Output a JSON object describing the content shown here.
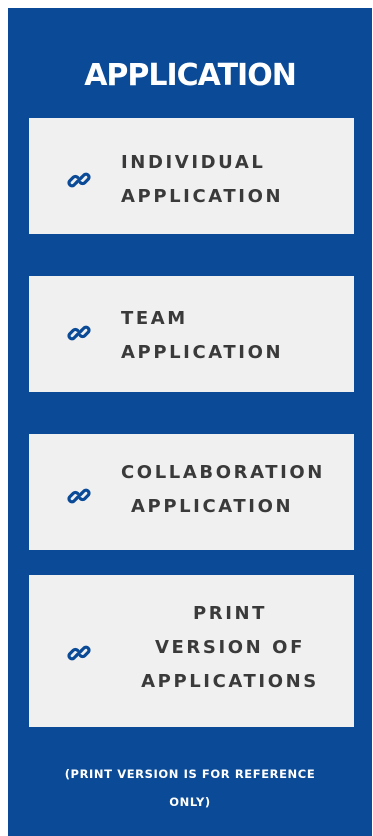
{
  "panel": {
    "title": "APPLICATION",
    "background_color": "#0a4a96",
    "card_color": "#f0f0f1",
    "icon_color": "#0a4a96",
    "links": [
      {
        "icon": "link-icon",
        "line1": "INDIVIDUAL",
        "line2": "APPLICATION"
      },
      {
        "icon": "link-icon",
        "line1": "TEAM",
        "line2": "APPLICATION"
      },
      {
        "icon": "link-icon",
        "line1": "COLLABORATION",
        "line2": "APPLICATION"
      },
      {
        "icon": "link-icon",
        "line1": "PRINT",
        "line2": "VERSION OF",
        "line3": "APPLICATIONS"
      }
    ],
    "note_line1": "(PRINT VERSION IS FOR REFERENCE",
    "note_line2": "ONLY)"
  }
}
